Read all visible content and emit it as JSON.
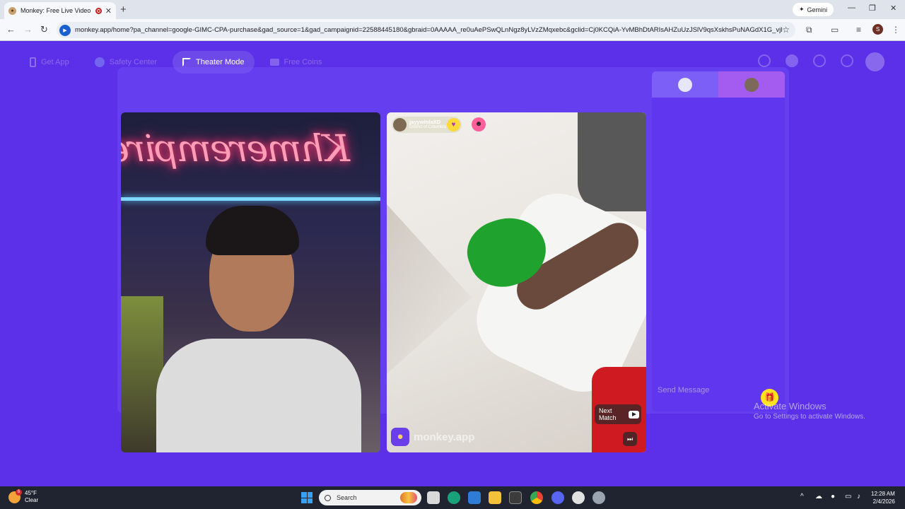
{
  "browser": {
    "tab_title": "Monkey: Free Live Video Ch",
    "new_tab": "+",
    "gemini_label": "Gemini",
    "url": "monkey.app/home?pa_channel=google-GIMC-CPA-purchase&gad_source=1&gad_campaignid=22588445180&gbraid=0AAAAA_re0uAePSwQLnNgz8yLVzZMqxebc&gclid=Cj0KCQiA-YvMBhDtARIsAHZuUzJSlV9qsXskhsPuNAGdX1G_vjR1eng...",
    "profile_initial": "S"
  },
  "nav": {
    "items": [
      {
        "label": "Get App",
        "icon": "phone-icon",
        "active": false
      },
      {
        "label": "Safety Center",
        "icon": "shield-icon",
        "active": false
      },
      {
        "label": "Theater Mode",
        "icon": "expand-icon",
        "active": true
      },
      {
        "label": "Free Coins",
        "icon": "coin-icon",
        "active": false
      }
    ],
    "right_icons": [
      "search-icon",
      "avatar-icon",
      "history-icon",
      "chat-icon"
    ]
  },
  "remote_user": {
    "name": "jayywitdaXD",
    "location": "District of Columbia"
  },
  "watermark": "monkey.app",
  "next_match_label": "Next Match",
  "chat": {
    "placeholder": "Send Message"
  },
  "activation": {
    "title": "Activate Windows",
    "subtitle": "Go to Settings to activate Windows."
  },
  "taskbar": {
    "temperature": "45°F",
    "condition": "Clear",
    "weather_badge": "6",
    "search_label": "Search",
    "time": "12:28 AM",
    "date": "2/4/2026"
  },
  "colors": {
    "app_bg": "#5b30e8",
    "accent": "#7c5ff7",
    "gift": "#ffe21a"
  }
}
